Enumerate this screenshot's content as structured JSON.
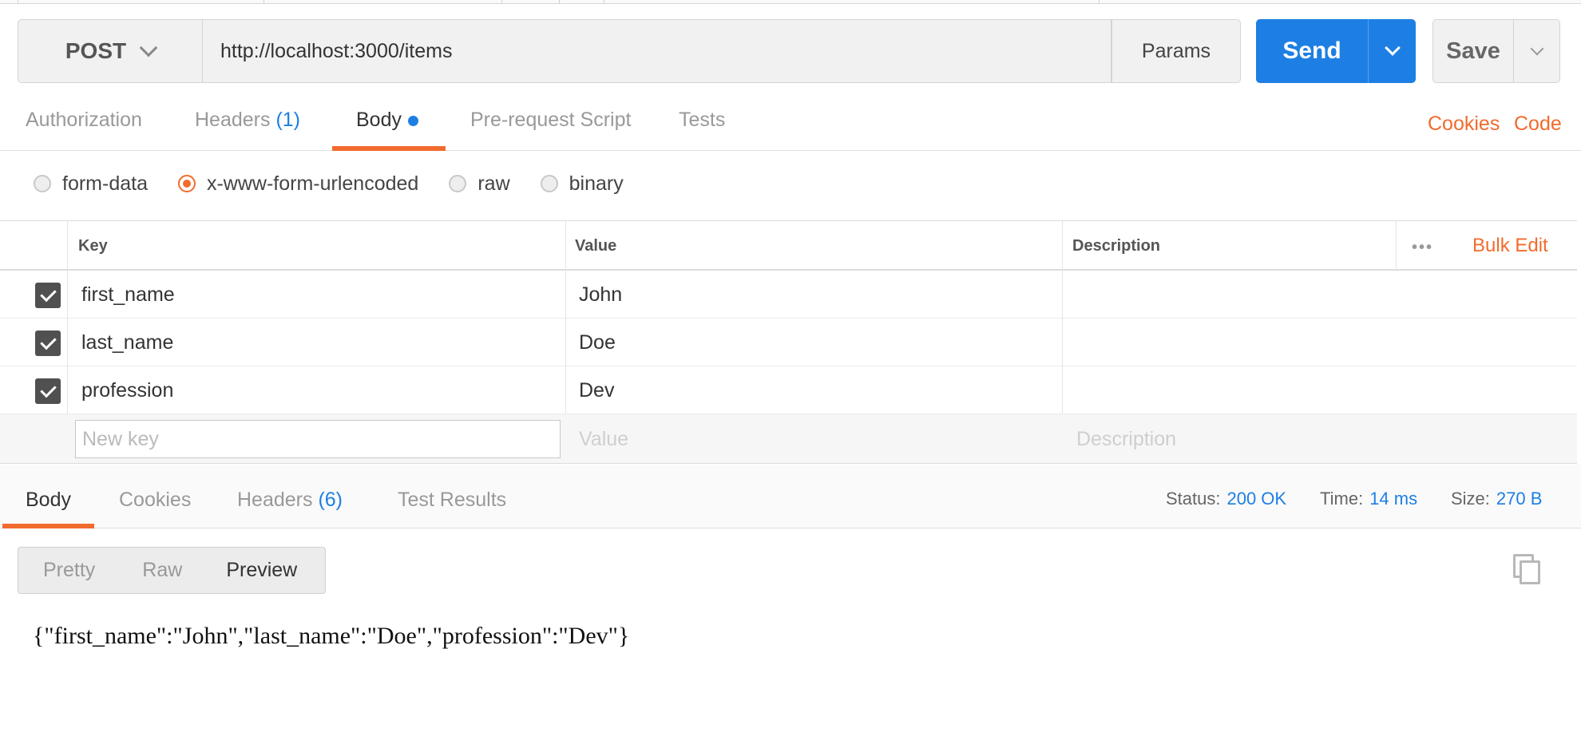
{
  "request": {
    "method": "POST",
    "url": "http://localhost:3000/items",
    "params_label": "Params",
    "send_label": "Send",
    "save_label": "Save"
  },
  "request_tabs": {
    "authorization": "Authorization",
    "headers": "Headers",
    "headers_count": "(1)",
    "body": "Body",
    "prerequest": "Pre-request Script",
    "tests": "Tests",
    "cookies_link": "Cookies",
    "code_link": "Code"
  },
  "body_types": {
    "form_data": "form-data",
    "urlencoded": "x-www-form-urlencoded",
    "raw": "raw",
    "binary": "binary",
    "selected": "x-www-form-urlencoded"
  },
  "params_table": {
    "headers": {
      "key": "Key",
      "value": "Value",
      "description": "Description",
      "more": "•••",
      "bulk_edit": "Bulk Edit"
    },
    "rows": [
      {
        "key": "first_name",
        "value": "John",
        "description": "",
        "checked": true
      },
      {
        "key": "last_name",
        "value": "Doe",
        "description": "",
        "checked": true
      },
      {
        "key": "profession",
        "value": "Dev",
        "description": "",
        "checked": true
      }
    ],
    "new_row": {
      "key_placeholder": "New key",
      "value_placeholder": "Value",
      "description_placeholder": "Description"
    }
  },
  "response_tabs": {
    "body": "Body",
    "cookies": "Cookies",
    "headers": "Headers",
    "headers_count": "(6)",
    "test_results": "Test Results"
  },
  "response_stats": {
    "status_label": "Status:",
    "status_value": "200 OK",
    "time_label": "Time:",
    "time_value": "14 ms",
    "size_label": "Size:",
    "size_value": "270 B"
  },
  "view_modes": {
    "pretty": "Pretty",
    "raw": "Raw",
    "preview": "Preview",
    "selected": "Preview"
  },
  "response_body": "{\"first_name\":\"John\",\"last_name\":\"Doe\",\"profession\":\"Dev\"}",
  "colors": {
    "accent_blue": "#1d7fe4",
    "accent_orange": "#f26b2e"
  }
}
